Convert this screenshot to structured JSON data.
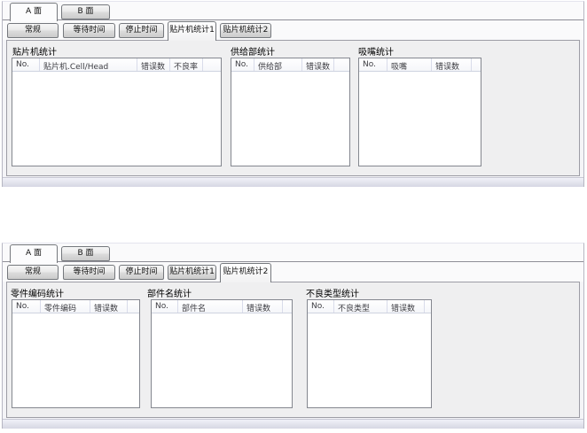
{
  "panels": [
    {
      "side_tabs": [
        {
          "label": "A 面",
          "selected": true
        },
        {
          "label": "B 面",
          "selected": false
        }
      ],
      "sub_tabs": [
        {
          "label": "常规",
          "selected": false
        },
        {
          "label": "等待时间",
          "selected": false
        },
        {
          "label": "停止时间",
          "selected": false
        },
        {
          "label": "贴片机统计1",
          "selected": true
        },
        {
          "label": "贴片机统计2",
          "selected": false
        }
      ],
      "groups": [
        {
          "title": "贴片机统计",
          "columns": [
            "No.",
            "贴片机.Cell/Head",
            "错误数",
            "不良率"
          ],
          "rows": []
        },
        {
          "title": "供给部统计",
          "columns": [
            "No.",
            "供给部",
            "错误数"
          ],
          "rows": []
        },
        {
          "title": "吸嘴统计",
          "columns": [
            "No.",
            "吸嘴",
            "错误数"
          ],
          "rows": []
        }
      ]
    },
    {
      "side_tabs": [
        {
          "label": "A 面",
          "selected": true
        },
        {
          "label": "B 面",
          "selected": false
        }
      ],
      "sub_tabs": [
        {
          "label": "常规",
          "selected": false
        },
        {
          "label": "等待时间",
          "selected": false
        },
        {
          "label": "停止时间",
          "selected": false
        },
        {
          "label": "贴片机统计1",
          "selected": false
        },
        {
          "label": "贴片机统计2",
          "selected": true
        }
      ],
      "groups": [
        {
          "title": "零件编码统计",
          "columns": [
            "No.",
            "零件编码",
            "错误数"
          ],
          "rows": []
        },
        {
          "title": "部件名统计",
          "columns": [
            "No.",
            "部件名",
            "错误数"
          ],
          "rows": []
        },
        {
          "title": "不良类型统计",
          "columns": [
            "No.",
            "不良类型",
            "错误数"
          ],
          "rows": []
        }
      ]
    }
  ],
  "colors": {
    "panel_background": "#f4f4f7",
    "tab_page_background": "#efeff0",
    "selected_tab_background": "#fcfcfd",
    "table_border": "#84878f",
    "header_separator": "#d9dcea",
    "status_strip_top": "#f0f1f8",
    "status_strip_bottom": "#d6d7e3"
  }
}
